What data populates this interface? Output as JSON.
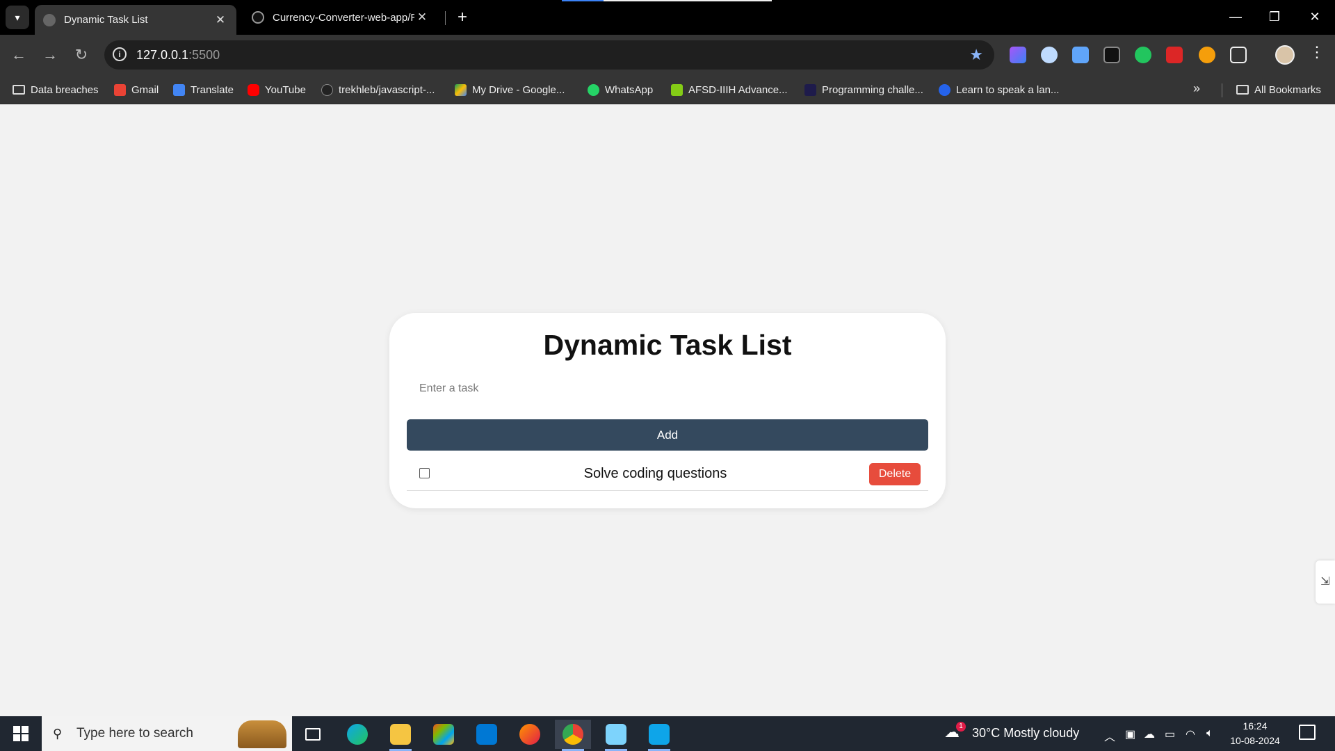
{
  "browser": {
    "tabs": [
      {
        "title": "Dynamic Task List",
        "active": true
      },
      {
        "title": "Currency-Converter-web-app/R",
        "active": false
      }
    ],
    "address": {
      "host": "127.0.0.1",
      "port": ":5500"
    },
    "bookmarks": [
      {
        "label": "Data breaches",
        "icon": "folder-icon"
      },
      {
        "label": "Gmail",
        "icon": "gmail-icon"
      },
      {
        "label": "Translate",
        "icon": "translate-icon"
      },
      {
        "label": "YouTube",
        "icon": "youtube-icon"
      },
      {
        "label": "trekhleb/javascript-...",
        "icon": "github-icon"
      },
      {
        "label": "My Drive - Google...",
        "icon": "google-drive-icon"
      },
      {
        "label": "WhatsApp",
        "icon": "whatsapp-icon"
      },
      {
        "label": "AFSD-IIIH Advance...",
        "icon": "afsd-icon"
      },
      {
        "label": "Programming challe...",
        "icon": "programming-icon"
      },
      {
        "label": "Learn to speak a lan...",
        "icon": "language-icon"
      }
    ],
    "all_bookmarks": "All Bookmarks"
  },
  "app": {
    "title": "Dynamic Task List",
    "input_placeholder": "Enter a task",
    "add_label": "Add",
    "tasks": [
      {
        "text": "Solve coding questions",
        "done": false,
        "delete_label": "Delete"
      }
    ]
  },
  "taskbar": {
    "search_placeholder": "Type here to search",
    "weather": "30°C  Mostly cloudy",
    "weather_badge": "1",
    "time": "16:24",
    "date": "10-08-2024"
  },
  "colors": {
    "add_button": "#34495e",
    "delete_button": "#e74c3c",
    "page_bg": "#f2f2f2"
  }
}
